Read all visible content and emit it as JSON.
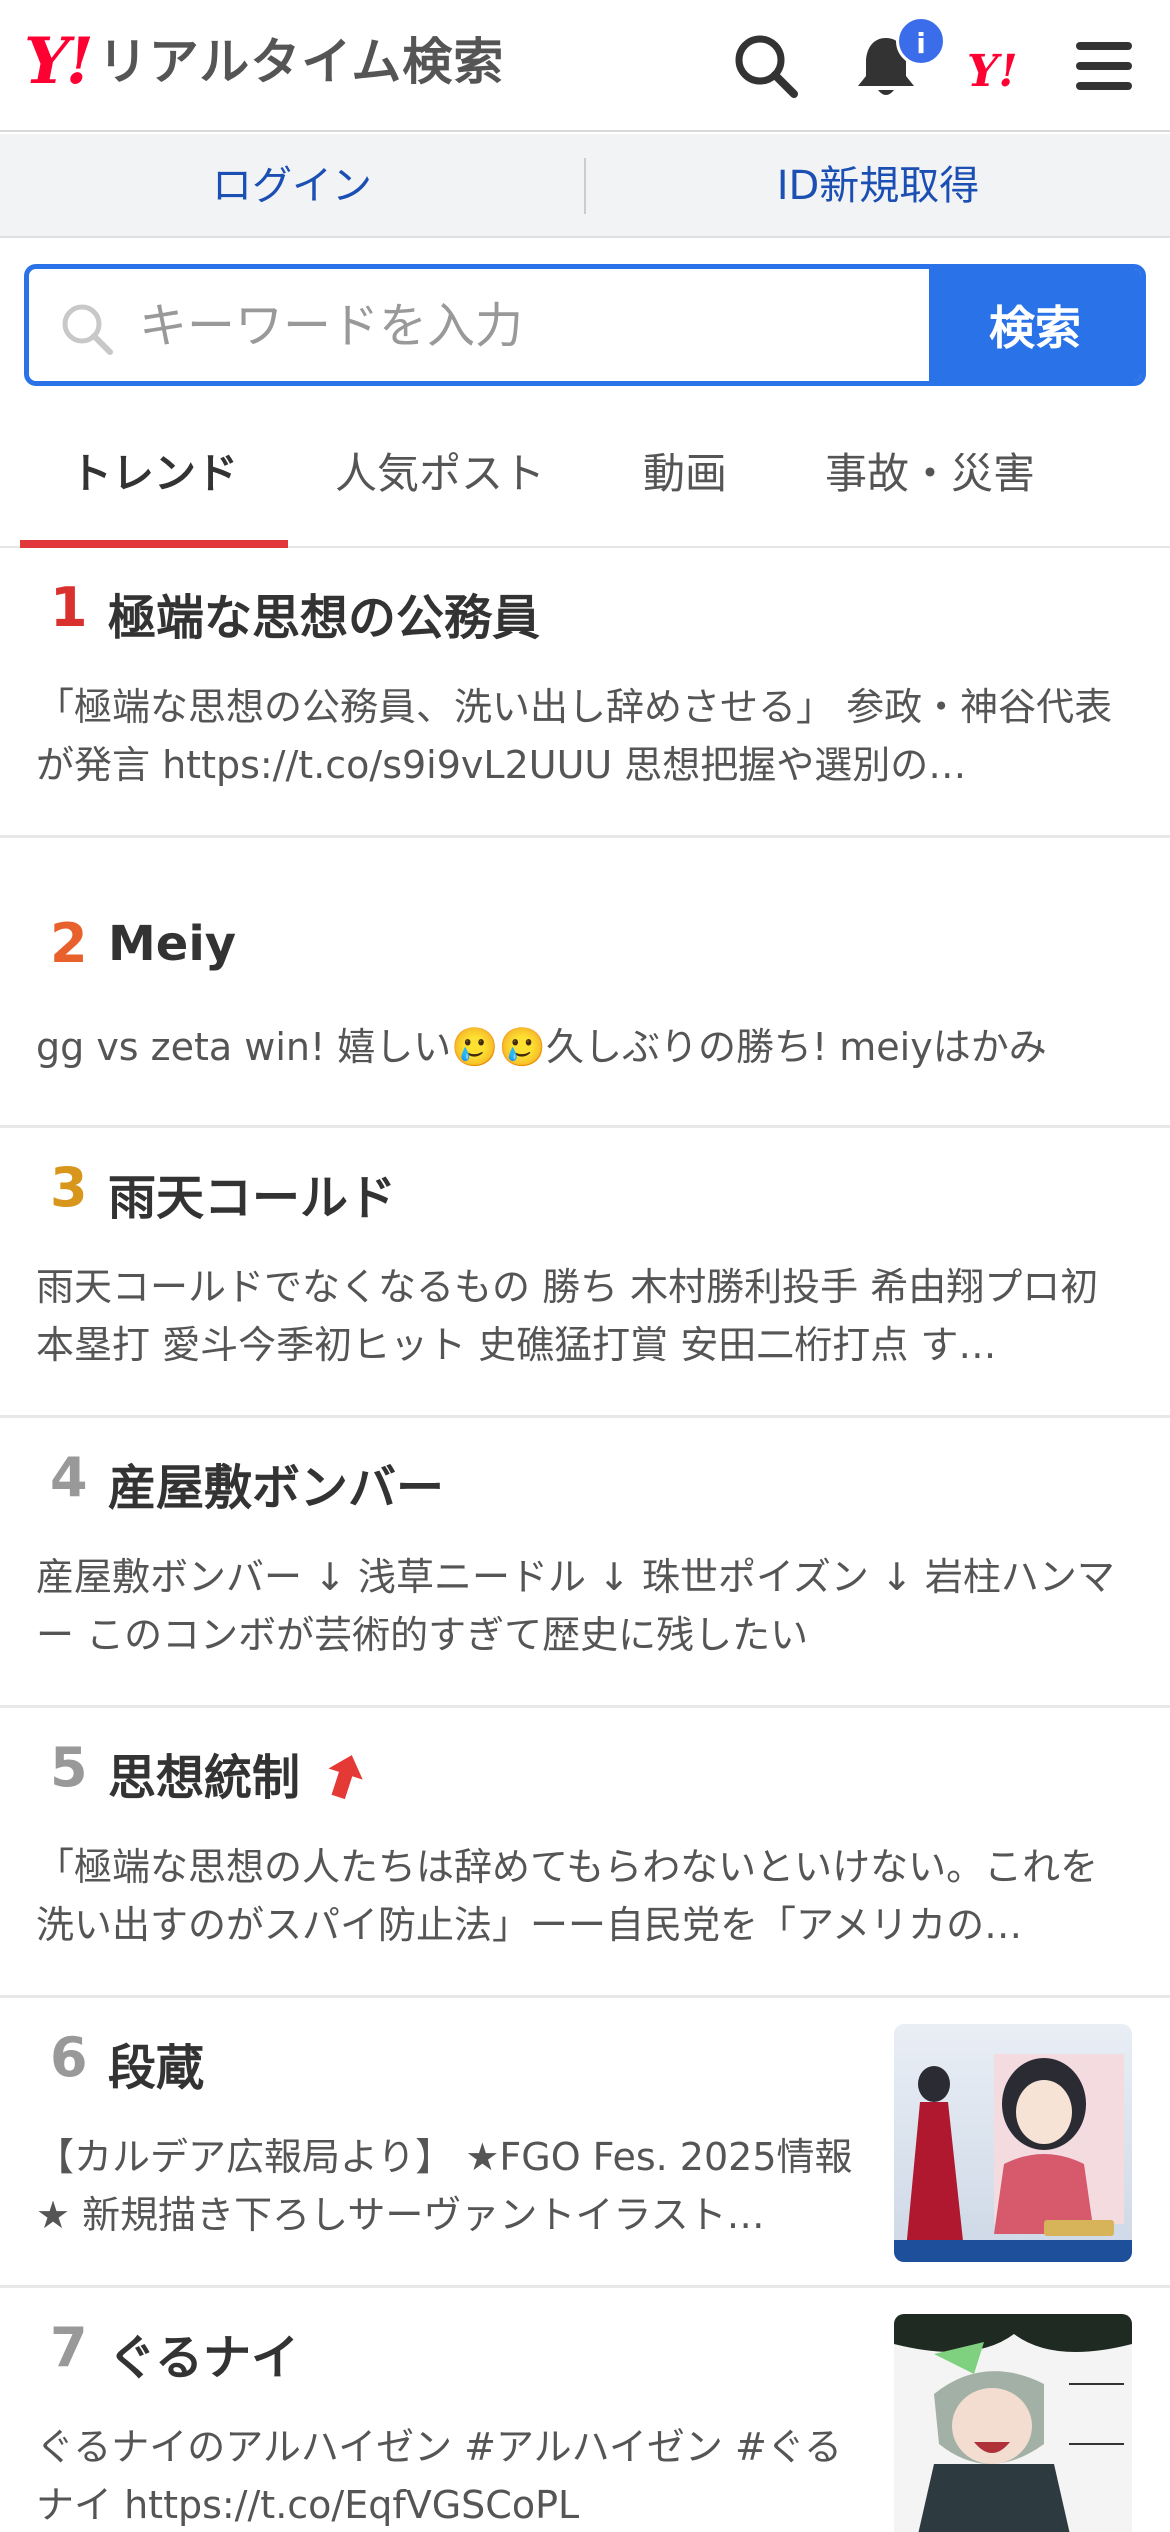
{
  "header": {
    "logo_mark": "Y!",
    "logo_title": "リアルタイム検索",
    "notification_count": "i",
    "yj_mark": "Y!"
  },
  "login": {
    "login_label": "ログイン",
    "register_label": "ID新規取得"
  },
  "search": {
    "placeholder": "キーワードを入力",
    "button_label": "検索"
  },
  "tabs": [
    {
      "label": "トレンド",
      "active": true
    },
    {
      "label": "人気ポスト",
      "active": false
    },
    {
      "label": "動画",
      "active": false
    },
    {
      "label": "事故・災害",
      "active": false
    }
  ],
  "colors": {
    "accent_blue": "#2a72e8",
    "link_blue": "#1c4fb3",
    "tab_underline": "#e1373a",
    "rank1": "#d9312e",
    "rank2": "#e8602c",
    "rank3": "#d9961d",
    "rank_other": "#999999"
  },
  "trends": [
    {
      "rank": "1",
      "title": "極端な思想の公務員",
      "desc": "「極端な思想の公務員、洗い出し辞めさせる」 参政・神谷代表が発言 https://t.co/s9i9vL2UUU 思想把握や選別の…"
    },
    {
      "rank": "2",
      "title": "Meiy",
      "desc": "gg vs zeta win! 嬉しい🥲🥲久しぶりの勝ち! meiyはかみ"
    },
    {
      "rank": "3",
      "title": "雨天コールド",
      "desc": "雨天コールドでなくなるもの 勝ち 木村勝利投手 希由翔プロ初本塁打 愛斗今季初ヒット 史礁猛打賞 安田二桁打点 す…"
    },
    {
      "rank": "4",
      "title": "産屋敷ボンバー",
      "desc": "産屋敷ボンバー ↓ 浅草ニードル ↓ 珠世ポイズン ↓ 岩柱ハンマー このコンボが芸術的すぎて歴史に残したい"
    },
    {
      "rank": "5",
      "title": "思想統制",
      "desc": "「極端な思想の人たちは辞めてもらわないといけない。これを洗い出すのがスパイ防止法」ーー自民党を「アメリカの…",
      "rising": true
    },
    {
      "rank": "6",
      "title": "段蔵",
      "desc": "【カルデア広報局より】 ★FGO Fes. 2025情報★ 新規描き下ろしサーヴァントイラスト…"
    },
    {
      "rank": "7",
      "title": "ぐるナイ",
      "desc": "ぐるナイのアルハイゼン #アルハイゼン #ぐるナイ https://t.co/EqfVGSCoPL"
    }
  ]
}
